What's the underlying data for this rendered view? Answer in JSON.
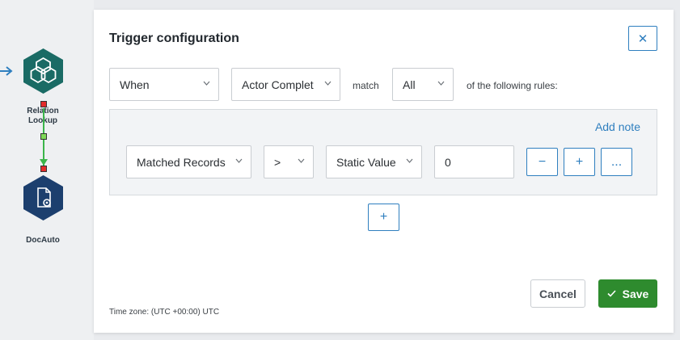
{
  "workflow": {
    "nodes": [
      {
        "label_line1": "Relation",
        "label_line2": "Lookup",
        "icon": "hexagon-link-icon",
        "color": "#1a6b65"
      },
      {
        "label_line1": "DocAuto",
        "icon": "document-gear-icon",
        "color": "#1c3f6e"
      }
    ],
    "colors": {
      "arrow": "#2f7fbf",
      "connector": "#3bb54a",
      "handle_red": "#e32b2b",
      "handle_green": "#7ed957"
    }
  },
  "modal": {
    "title": "Trigger configuration",
    "close_icon": "close-icon",
    "condition": {
      "when_value": "When",
      "event_value": "Actor Complet",
      "match_label": "match",
      "match_value": "All",
      "suffix_label": "of the following rules:"
    },
    "rules": {
      "add_note_label": "Add note",
      "items": [
        {
          "field_value": "Matched Records",
          "operator_value": ">",
          "value_type": "Static Value",
          "value": "0",
          "remove_label": "−",
          "add_label": "+",
          "more_label": "..."
        }
      ]
    },
    "add_rule_label": "+",
    "footer": {
      "cancel_label": "Cancel",
      "save_label": "Save",
      "timezone_text": "Time zone: (UTC +00:00) UTC"
    },
    "colors": {
      "accent": "#2f7fbf",
      "save": "#2e8b2e"
    }
  }
}
